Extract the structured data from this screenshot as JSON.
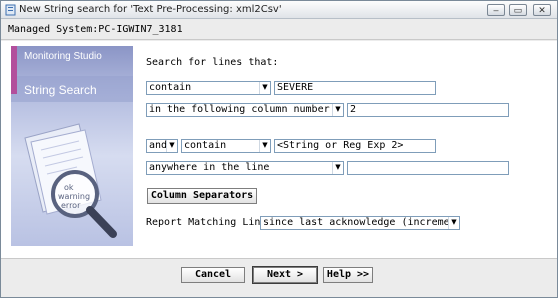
{
  "window": {
    "title": "New String search for 'Text Pre-Processing: xml2Csv'",
    "controls": {
      "minimize": "–",
      "maximize": "▭",
      "close": "✕"
    }
  },
  "system": {
    "label": "Managed System:PC-IGWIN7_3181"
  },
  "side_panel": {
    "product": "Monitoring Studio",
    "heading": "String Search",
    "illustration_text": [
      "ok",
      "warning",
      "error"
    ],
    "colors": {
      "accent": "#b24f9c",
      "panel": "#b4bde0"
    }
  },
  "form": {
    "search_label": "Search for lines that:",
    "condition1": {
      "operator": "contain",
      "value": "SEVERE",
      "location": "in the following column number:",
      "column": "2"
    },
    "condition2": {
      "joiner": "and",
      "operator": "contain",
      "value": "<String or Reg Exp 2>",
      "location": "anywhere in the line",
      "column": ""
    },
    "column_separators_label": "Column Separators",
    "report_label": "Report Matching Lines",
    "report_value": "since last acknowledge (incremental)"
  },
  "footer": {
    "cancel": "Cancel",
    "next": "Next >",
    "help": "Help >>"
  }
}
